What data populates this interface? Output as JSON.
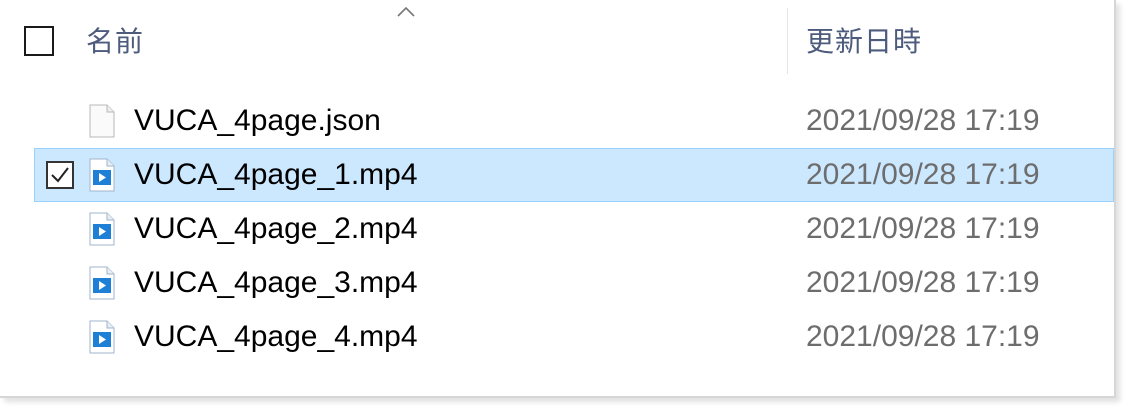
{
  "header": {
    "name_label": "名前",
    "date_label": "更新日時",
    "sort_icon": "chevron-up-icon"
  },
  "files": [
    {
      "name": "VUCA_4page.json",
      "modified": "2021/09/28 17:19",
      "icon": "json-file-icon",
      "selected": false
    },
    {
      "name": "VUCA_4page_1.mp4",
      "modified": "2021/09/28 17:19",
      "icon": "video-file-icon",
      "selected": true
    },
    {
      "name": "VUCA_4page_2.mp4",
      "modified": "2021/09/28 17:19",
      "icon": "video-file-icon",
      "selected": false
    },
    {
      "name": "VUCA_4page_3.mp4",
      "modified": "2021/09/28 17:19",
      "icon": "video-file-icon",
      "selected": false
    },
    {
      "name": "VUCA_4page_4.mp4",
      "modified": "2021/09/28 17:19",
      "icon": "video-file-icon",
      "selected": false
    }
  ],
  "colors": {
    "selection_bg": "#cce8ff",
    "selection_border": "#99d1ff",
    "header_text": "#4d5b7c",
    "date_text": "#6d6d6d",
    "video_icon_blue": "#1e7fd6"
  }
}
